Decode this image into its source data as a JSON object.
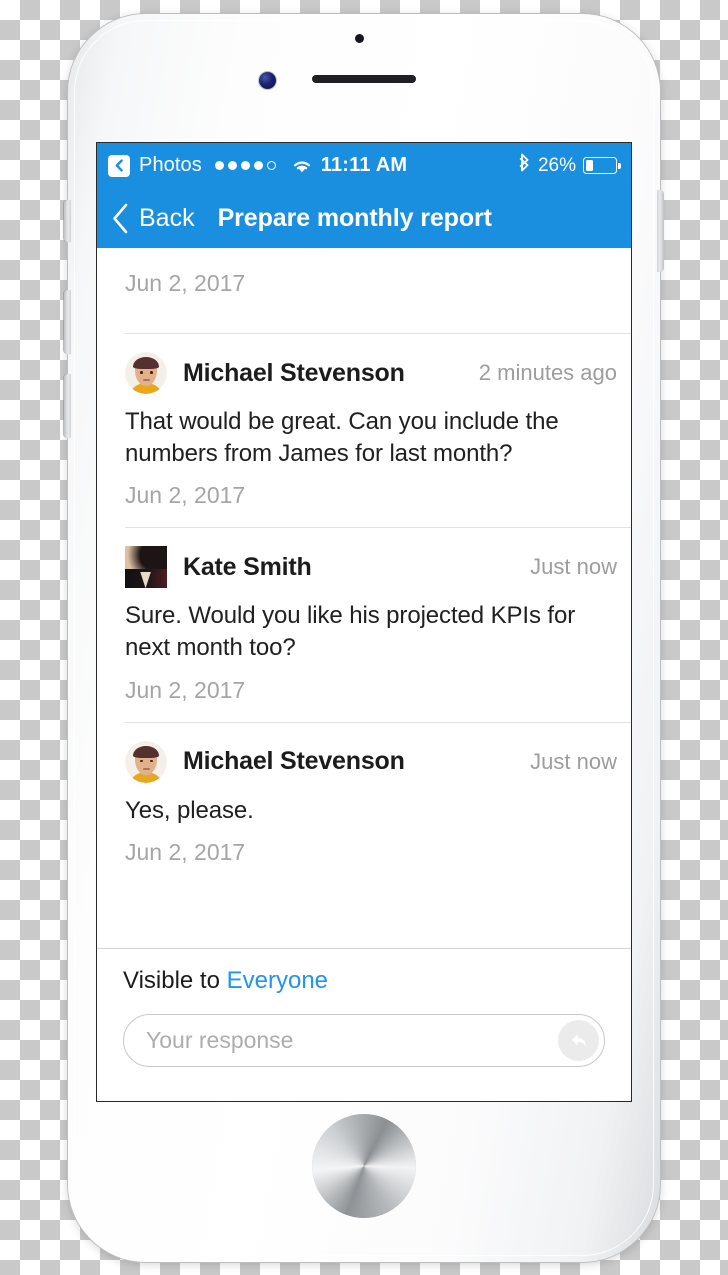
{
  "device": {
    "name": "white-iphone-mockup",
    "hardware_icons": [
      "front-camera",
      "proximity-sensor",
      "earpiece-speaker",
      "home-button",
      "silence-switch",
      "volume-up-button",
      "volume-down-button",
      "power-button"
    ]
  },
  "status_bar": {
    "back_app_label": "Photos",
    "back_icon": "chevron-left-icon",
    "signal_dots_filled": 4,
    "signal_dots_total": 5,
    "wifi_icon": "wifi-icon",
    "time": "11:11 AM",
    "bluetooth_icon": "bluetooth-icon",
    "battery_percent_label": "26%",
    "battery_level": 26,
    "background_color": "#1a8fe0",
    "text_color": "#ffffff"
  },
  "nav_bar": {
    "back_icon": "chevron-left-icon",
    "back_label": "Back",
    "title": "Prepare monthly report",
    "background_color": "#1a8fe0"
  },
  "conversation": {
    "partial_top_message": {
      "date": "Jun 2, 2017"
    },
    "messages": [
      {
        "author": "Michael Stevenson",
        "avatar": "avatar-michael-stevenson",
        "avatar_type": "cartoon-circle",
        "relative_time": "2 minutes ago",
        "body": "That would be great. Can you include the numbers from James for last month?",
        "date": "Jun 2, 2017"
      },
      {
        "author": "Kate Smith",
        "avatar": "avatar-kate-smith",
        "avatar_type": "photo-square",
        "relative_time": "Just now",
        "body": "Sure. Would you like his projected KPIs for next month too?",
        "date": "Jun 2, 2017"
      },
      {
        "author": "Michael Stevenson",
        "avatar": "avatar-michael-stevenson",
        "avatar_type": "cartoon-circle",
        "relative_time": "Just now",
        "body": "Yes, please.",
        "date": "Jun 2, 2017"
      }
    ]
  },
  "composer": {
    "visibility_prefix": "Visible to",
    "visibility_value": "Everyone",
    "visibility_link_color": "#2196e8",
    "input_placeholder": "Your response",
    "input_value": "",
    "send_icon": "reply-arrow-icon"
  }
}
